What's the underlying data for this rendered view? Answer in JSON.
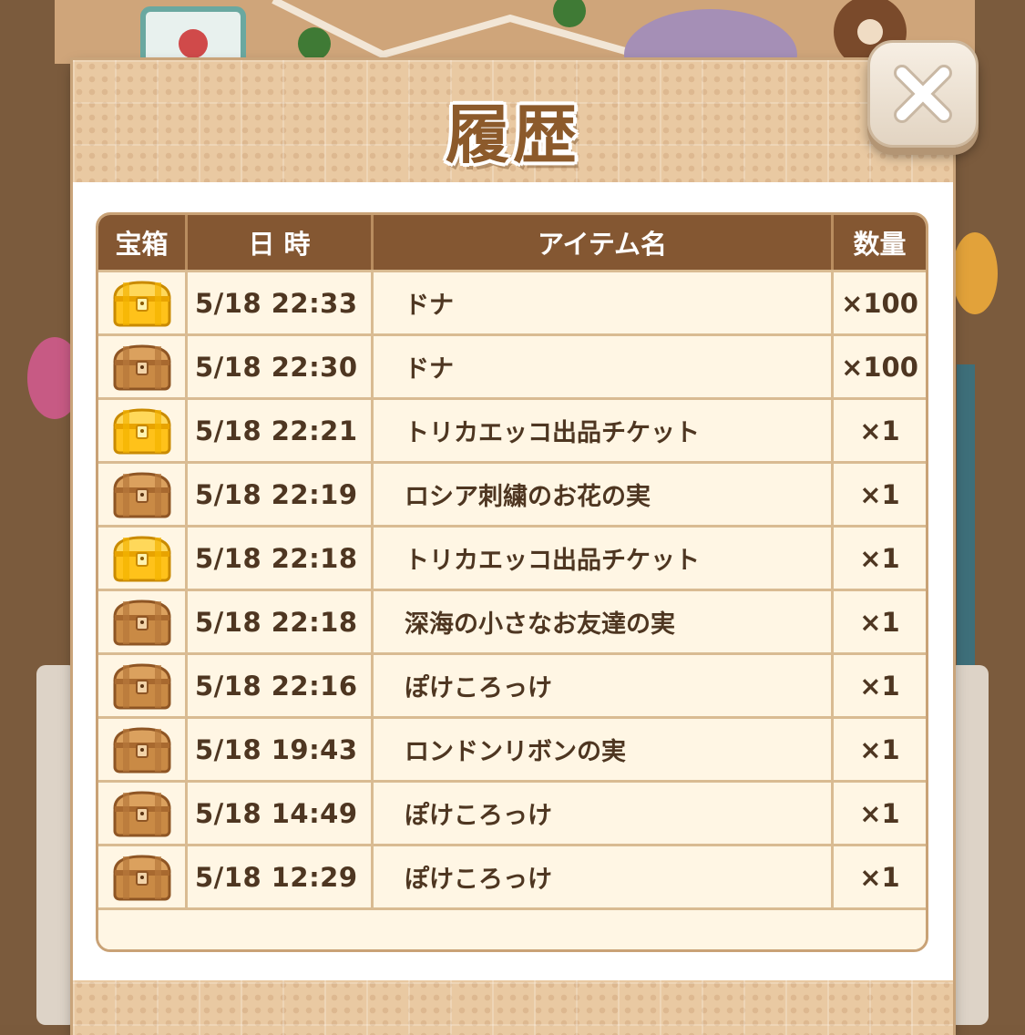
{
  "dialog": {
    "title": "履歴",
    "close_icon": "close-x-icon"
  },
  "table": {
    "headers": {
      "chest": "宝箱",
      "datetime": "日 時",
      "item_name": "アイテム名",
      "quantity": "数量"
    },
    "rows": [
      {
        "chest": "gold-chest-icon",
        "datetime": "5/18 22:33",
        "item": "ドナ",
        "quantity": "×100"
      },
      {
        "chest": "bronze-chest-icon",
        "datetime": "5/18 22:30",
        "item": "ドナ",
        "quantity": "×100"
      },
      {
        "chest": "gold-chest-icon",
        "datetime": "5/18 22:21",
        "item": "トリカエッコ出品チケット",
        "quantity": "×1"
      },
      {
        "chest": "bronze-chest-icon",
        "datetime": "5/18 22:19",
        "item": "ロシア刺繍のお花の実",
        "quantity": "×1"
      },
      {
        "chest": "gold-chest-icon",
        "datetime": "5/18 22:18",
        "item": "トリカエッコ出品チケット",
        "quantity": "×1"
      },
      {
        "chest": "bronze-chest-icon",
        "datetime": "5/18 22:18",
        "item": "深海の小さなお友達の実",
        "quantity": "×1"
      },
      {
        "chest": "bronze-chest-icon",
        "datetime": "5/18 22:16",
        "item": "ぽけころっけ",
        "quantity": "×1"
      },
      {
        "chest": "bronze-chest-icon",
        "datetime": "5/18 19:43",
        "item": "ロンドンリボンの実",
        "quantity": "×1"
      },
      {
        "chest": "bronze-chest-icon",
        "datetime": "5/18 14:49",
        "item": "ぽけころっけ",
        "quantity": "×1"
      },
      {
        "chest": "bronze-chest-icon",
        "datetime": "5/18 12:29",
        "item": "ぽけころっけ",
        "quantity": "×1"
      }
    ]
  },
  "colors": {
    "header_bg": "#845732",
    "title_text": "#8c5a2b",
    "gold_chest": "#ffc21a",
    "bronze_chest": "#c98a45"
  }
}
